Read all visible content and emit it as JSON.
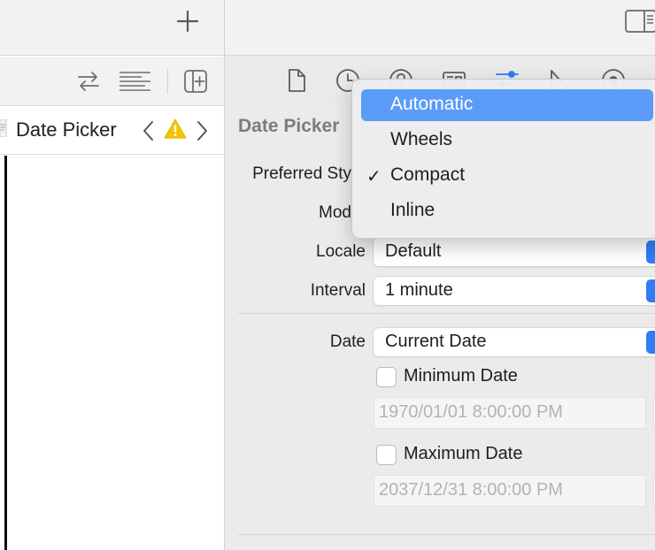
{
  "left_pane": {
    "jump_bar": {
      "title": "Date Picker"
    }
  },
  "inspector": {
    "tabs": [
      "file-inspector",
      "history-inspector",
      "quick-help-inspector",
      "identity-inspector",
      "attributes-inspector",
      "size-inspector",
      "connections-inspector"
    ],
    "active_tab": "attributes-inspector",
    "section_title": "Date Picker",
    "labels": {
      "preferred_style": "Preferred Sty",
      "mode": "Mod",
      "locale": "Locale",
      "interval": "Interval",
      "date": "Date"
    },
    "locale_value": "Default",
    "interval_value": "1 minute",
    "date_value": "Current Date",
    "minimum_date": {
      "label": "Minimum Date",
      "checked": false,
      "value": "1970/01/01   8:00:00 PM"
    },
    "maximum_date": {
      "label": "Maximum Date",
      "checked": false,
      "value": "2037/12/31   8:00:00 PM"
    }
  },
  "dropdown": {
    "items": [
      {
        "label": "Automatic",
        "highlighted": true,
        "checked": false
      },
      {
        "label": "Wheels",
        "highlighted": false,
        "checked": false
      },
      {
        "label": "Compact",
        "highlighted": false,
        "checked": true,
        "check_mark": "✓"
      },
      {
        "label": "Inline",
        "highlighted": false,
        "checked": false
      }
    ]
  },
  "colors": {
    "accent": "#2f7cf6",
    "menu_highlight": "#5b9cf8",
    "warning": "#f5c400"
  }
}
